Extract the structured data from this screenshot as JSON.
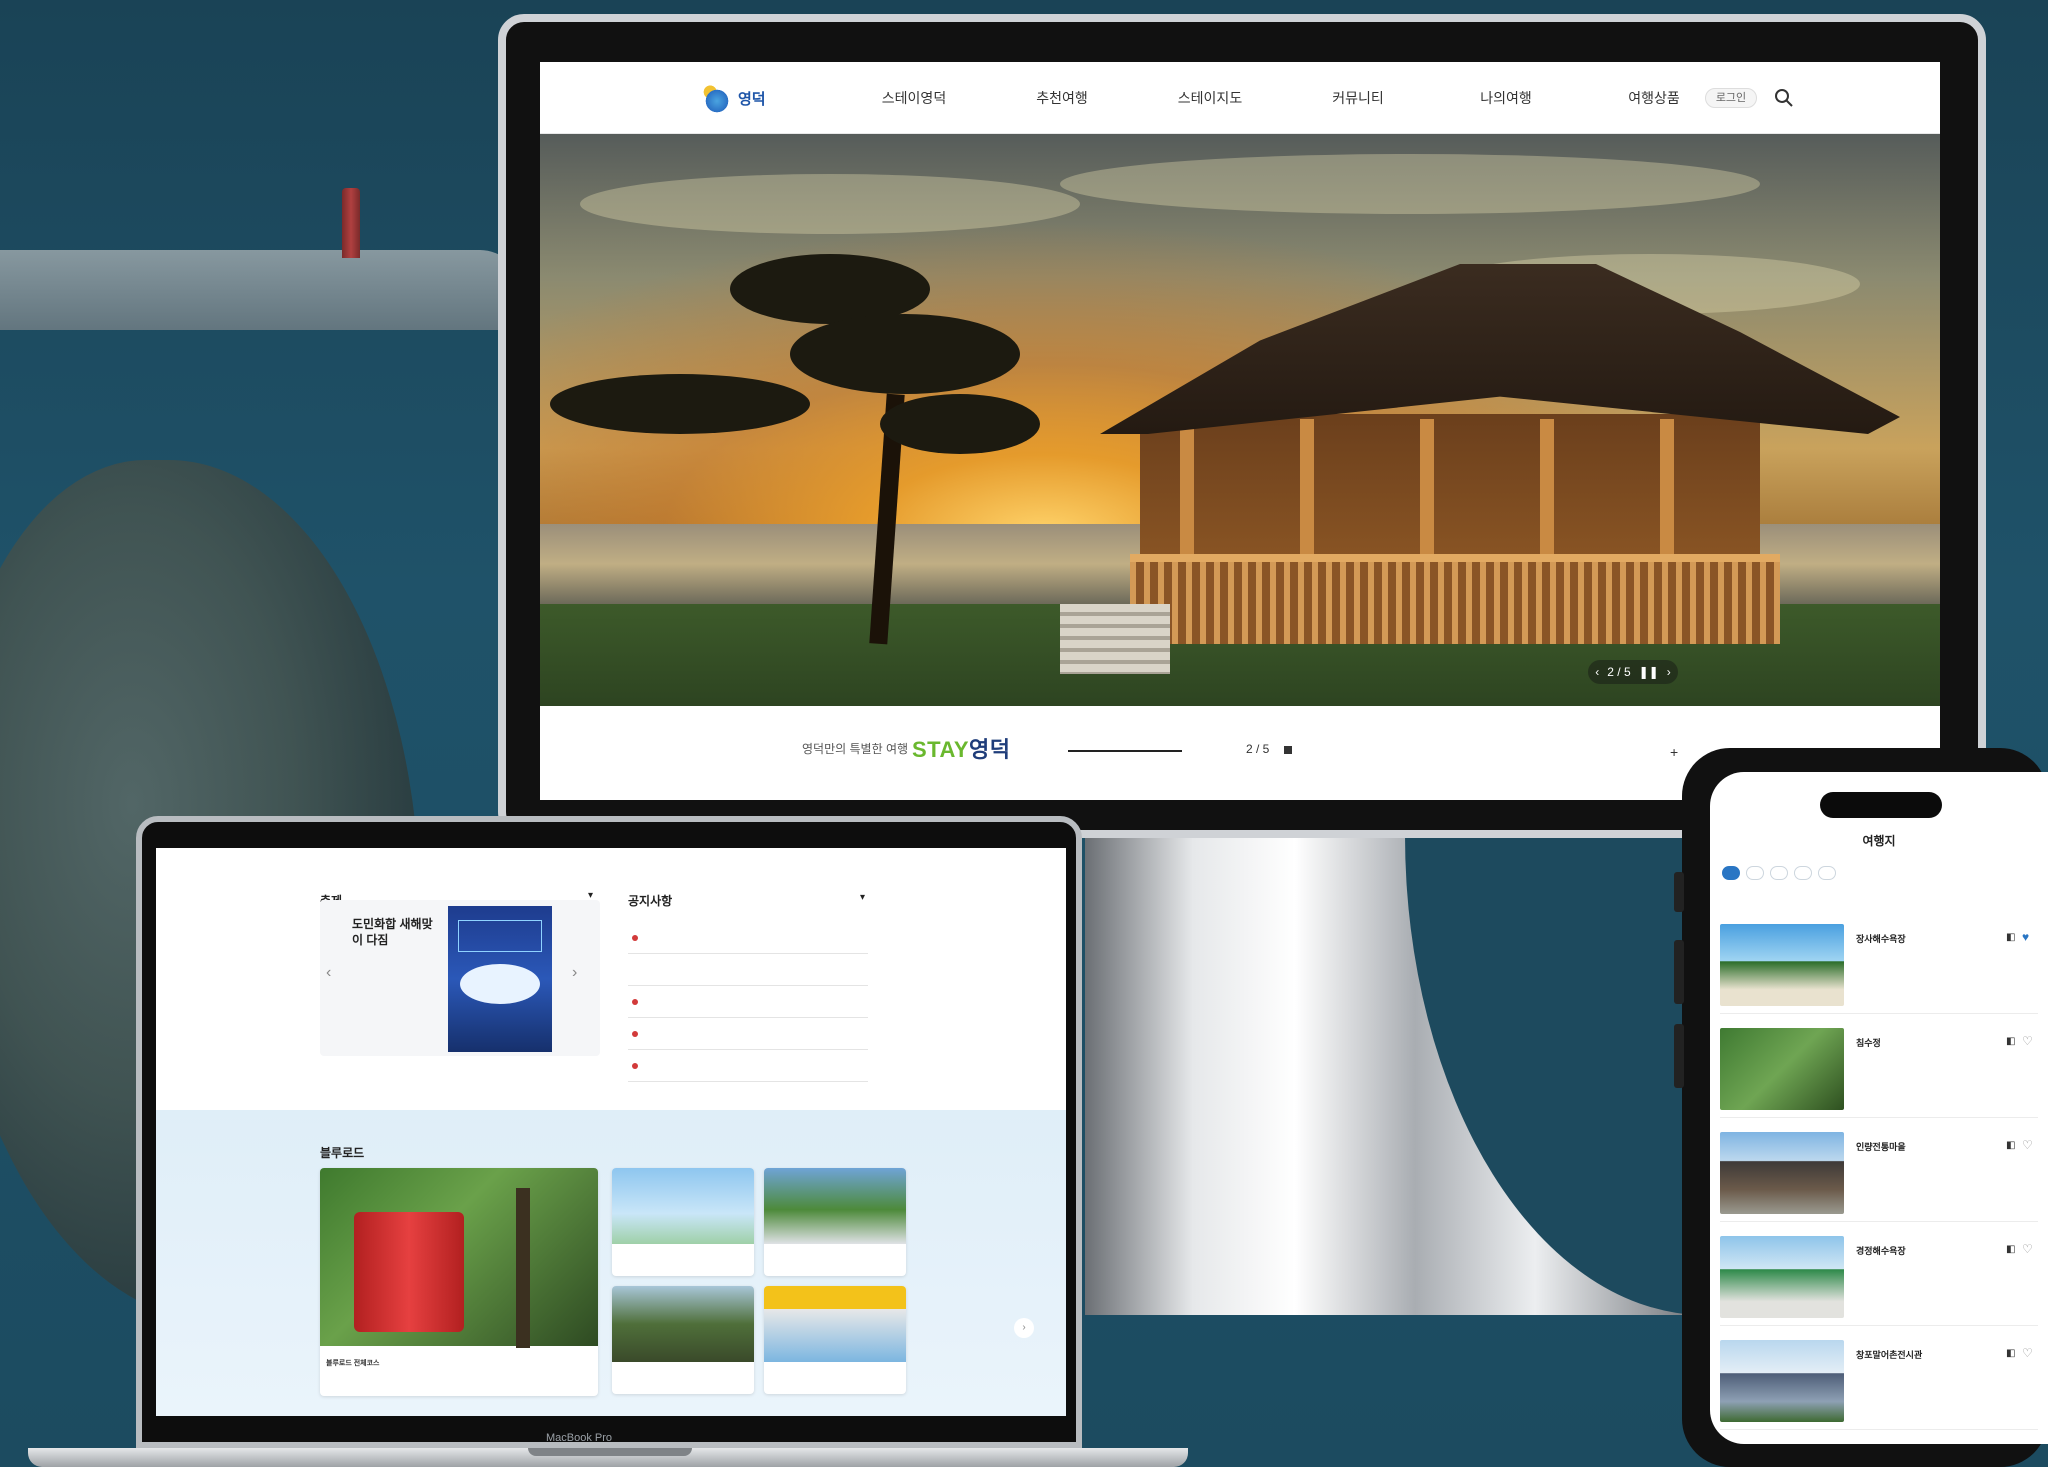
{
  "monitor": {
    "nav": {
      "logo": "영덕",
      "items": [
        "스테이영덕",
        "추천여행",
        "스테이지도",
        "커뮤니티",
        "나의여행",
        "여행상품"
      ],
      "login": "로그인"
    },
    "hero": {
      "pager": "2 / 5",
      "pager_prev": "‹",
      "pager_next": "›",
      "pager_pause": "❚❚",
      "caption_prefix": "영덕만의 특별한 여행",
      "caption_brand_a": "STAY",
      "caption_brand_b": "영덕",
      "slide_count": "2 / 5",
      "plus": "+"
    }
  },
  "laptop": {
    "festival": {
      "title": "축제",
      "subtitle": "",
      "event_title": "도민화합 새해맞이 다짐",
      "event_meta": "",
      "more": "",
      "prev": "‹",
      "next": "›",
      "toggle": "▾"
    },
    "notice": {
      "title": "공지사항",
      "toggle": "▾",
      "rows": [
        {
          "text": "",
          "date": ""
        },
        {
          "text": "",
          "date": ""
        },
        {
          "text": "",
          "date": ""
        },
        {
          "text": "",
          "date": ""
        },
        {
          "text": "",
          "date": ""
        }
      ]
    },
    "blueroad": {
      "title": "블루로드",
      "subtitle": "",
      "cards": [
        {
          "caption": "블루로드 전체코스"
        },
        {
          "caption": ""
        },
        {
          "caption": ""
        },
        {
          "caption": ""
        },
        {
          "caption": ""
        }
      ],
      "next": "›"
    },
    "brand": "MacBook Pro"
  },
  "phone": {
    "tabs": [
      "",
      "",
      ""
    ],
    "title": "여행지",
    "chips": [
      "",
      "",
      "",
      "",
      ""
    ],
    "total": "",
    "sort": "",
    "items": [
      {
        "name": "장사해수욕장",
        "addr": "",
        "desc": "",
        "liked": true
      },
      {
        "name": "침수정",
        "addr": "",
        "desc": "",
        "liked": false
      },
      {
        "name": "인량전통마을",
        "addr": "",
        "desc": "",
        "liked": false
      },
      {
        "name": "경정해수욕장",
        "addr": "",
        "desc": "",
        "liked": false
      },
      {
        "name": "창포말어촌전시관",
        "addr": "",
        "desc": "",
        "liked": false
      }
    ]
  },
  "colors": {
    "accent_blue": "#2a76c4",
    "brand_green": "#6ab82e",
    "brand_navy": "#1f3d7a",
    "background": "#1d4a5e"
  },
  "icons": {
    "search": "search-icon",
    "heart": "heart-icon",
    "map": "map-icon"
  }
}
